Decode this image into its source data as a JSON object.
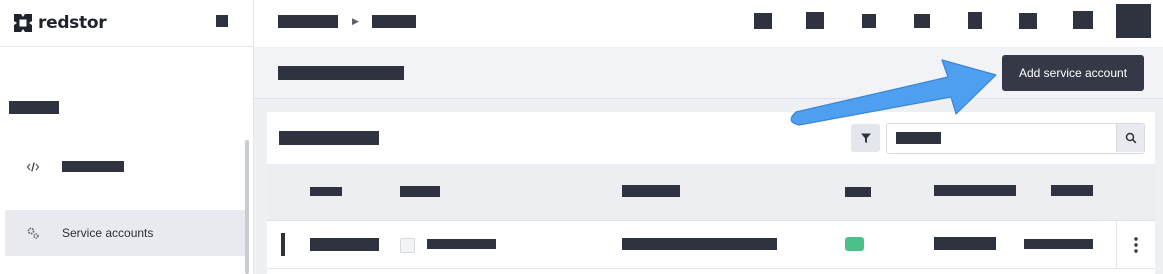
{
  "brand": {
    "name": "redstor"
  },
  "sidebar": {
    "items": [
      {
        "label": "",
        "icon": "code-icon"
      },
      {
        "label": "Service accounts",
        "icon": "gears-icon",
        "active": true
      }
    ]
  },
  "page": {
    "add_button_label": "Add service account"
  },
  "toolbar": {
    "filter_icon": "funnel-icon",
    "search_icon": "magnifier-icon"
  },
  "row": {
    "status_color": "#4cbf8a",
    "menu_icon": "kebab-icon"
  },
  "colors": {
    "primary_button": "#353846",
    "annotation_arrow": "#4f9ff0"
  }
}
